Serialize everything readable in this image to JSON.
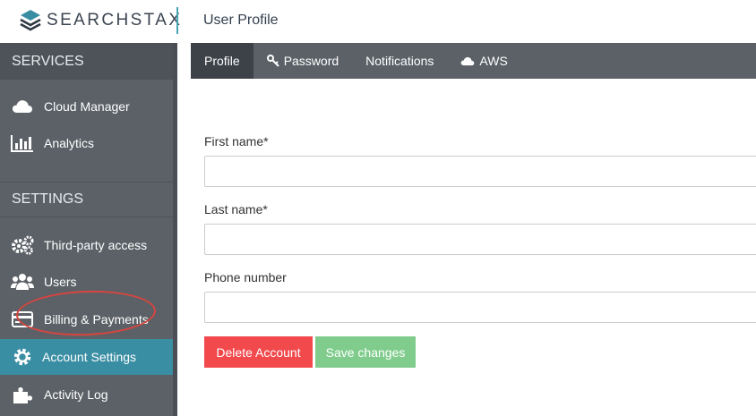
{
  "header": {
    "logo_text": "SEARCHSTAX",
    "page_title": "User Profile"
  },
  "sidebar": {
    "services_header": "SERVICES",
    "settings_header": "SETTINGS",
    "items": [
      {
        "label": "Cloud Manager",
        "icon": "cloud-icon"
      },
      {
        "label": "Analytics",
        "icon": "bar-chart-icon"
      },
      {
        "label": "Third-party access",
        "icon": "gears-icon"
      },
      {
        "label": "Users",
        "icon": "users-icon"
      },
      {
        "label": "Billing & Payments",
        "icon": "credit-card-icon"
      },
      {
        "label": "Account Settings",
        "icon": "gear-icon",
        "active": true
      },
      {
        "label": "Activity Log",
        "icon": "puzzle-icon"
      }
    ]
  },
  "tabs": [
    {
      "label": "Profile",
      "active": true
    },
    {
      "label": "Password",
      "icon": "key-icon"
    },
    {
      "label": "Notifications"
    },
    {
      "label": "AWS",
      "icon": "cloud-icon"
    }
  ],
  "form": {
    "first_name_label": "First name*",
    "first_name_value": "",
    "last_name_label": "Last name*",
    "last_name_value": "",
    "phone_label": "Phone number",
    "phone_value": "",
    "delete_label": "Delete Account",
    "save_label": "Save changes"
  },
  "colors": {
    "sidebar": "#5b6167",
    "active": "#3a8ea3",
    "delete": "#f2494d",
    "save": "#7fcc8c",
    "annotation": "#d9453f"
  }
}
